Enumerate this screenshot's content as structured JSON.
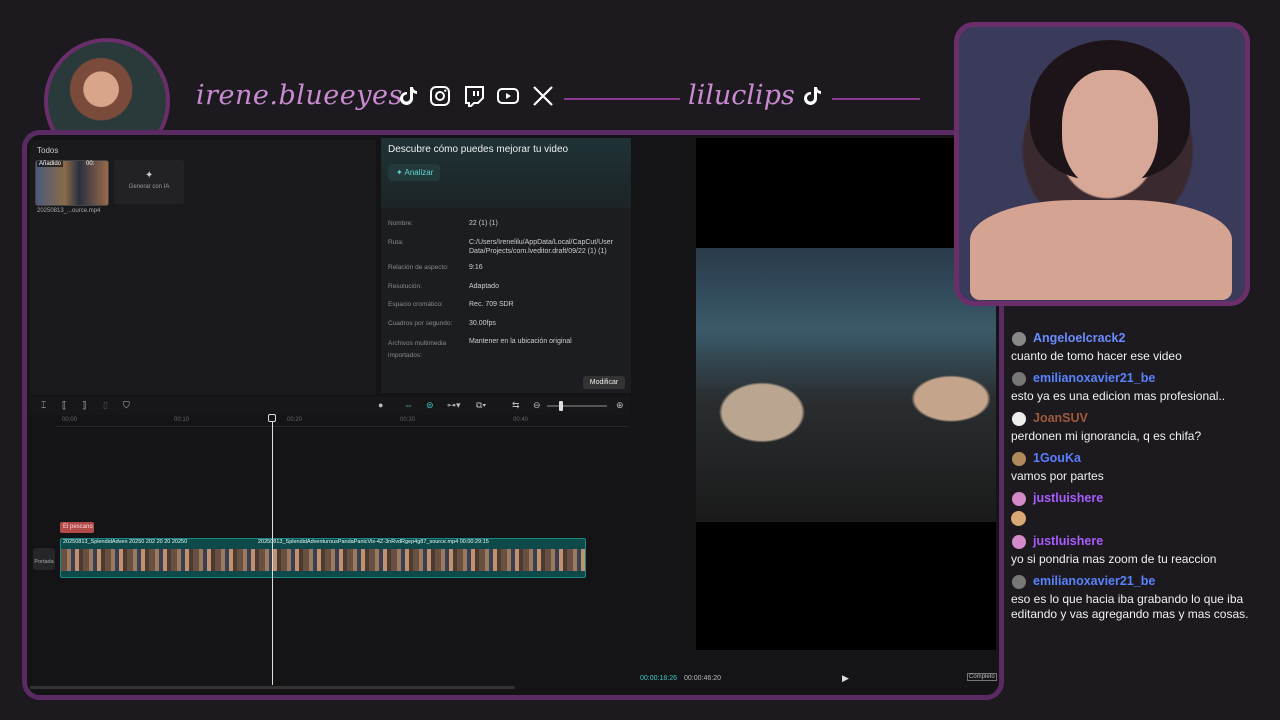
{
  "overlay": {
    "streamer_handle": "irene.blueeyes",
    "clip_handle": "liluclips",
    "social_icons": [
      "tiktok-icon",
      "instagram-icon",
      "twitch-icon",
      "youtube-icon",
      "x-icon"
    ],
    "accent_color": "#8a3a90"
  },
  "media_panel": {
    "tab": "Todos",
    "thumb_tag": "Añadido",
    "thumb_duration": "00:",
    "thumb_name": "20250813_...ource.mp4",
    "ai_card_label": "Generar con IA"
  },
  "details_panel": {
    "title": "Descubre cómo puedes mejorar tu video",
    "analyze_label": "Analizar",
    "rows": [
      {
        "key": "Nombre:",
        "value": "22 (1) (1)"
      },
      {
        "key": "Ruta:",
        "value": "C:/Users/Irenelilu/AppData/Local/CapCut/User Data/Projects/com.lveditor.draft/09/22 (1) (1)"
      },
      {
        "key": "Relación de aspecto:",
        "value": "9:16"
      },
      {
        "key": "Resolución:",
        "value": "Adaptado"
      },
      {
        "key": "Espacio cromático:",
        "value": "Rec. 709 SDR"
      },
      {
        "key": "Cuadros por segundo:",
        "value": "30.00fps"
      },
      {
        "key": "Archivos multimedia importados:",
        "value": "Mantener en la ubicación original"
      }
    ],
    "modify_label": "Modificar"
  },
  "timeline": {
    "ticks": [
      "00:00",
      "00:10",
      "00:20",
      "00:30",
      "00:40"
    ],
    "sticker_label": "El pescano",
    "cover_label": "Portada",
    "clip1_title": "20250813_SplendidAdven  20250  202  20  20  20250",
    "clip2_title": "20250813_SplendidAdventurousPandaPanicVis-4Z-3nRvdRgep4g87_source.mp4   00:00:29:15",
    "zoom_level": 0.2
  },
  "player": {
    "current_time": "00:00:18:26",
    "total_time": "00:00:46:20",
    "fullscreen_label": "Completo"
  },
  "chat": [
    {
      "user": "Angeloelcrack2",
      "color": "#6a8cff",
      "badge": "#888",
      "msg": "cuanto de tomo hacer ese video"
    },
    {
      "user": "emilianoxavier21_be",
      "color": "#5a82ff",
      "badge": "#777",
      "msg": "esto ya es una edicion mas profesional.."
    },
    {
      "user": "JoanSUV",
      "color": "#a0583a",
      "badge": "#eee",
      "msg": "perdonen mi ignorancia, q es chifa?"
    },
    {
      "user": "1GouKa",
      "color": "#5a7cff",
      "badge": "#b08a5a",
      "msg": "vamos por partes"
    },
    {
      "user": "justluishere",
      "color": "#a85cff",
      "badge": "#d48ac8",
      "msg": ""
    },
    {
      "user": "justluishere",
      "color": "#a85cff",
      "badge": "#d48ac8",
      "msg": "yo si pondria mas zoom de tu reaccion"
    },
    {
      "user": "emilianoxavier21_be",
      "color": "#5a82ff",
      "badge": "#777",
      "msg": "eso es lo que hacia iba grabando lo que iba editando y vas agregando mas y mas cosas."
    }
  ]
}
